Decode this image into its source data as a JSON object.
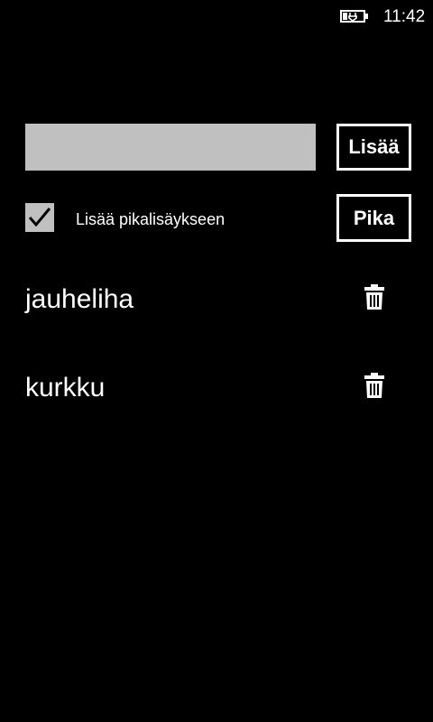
{
  "status_bar": {
    "time": "11:42",
    "battery_icon": "battery-charging-icon"
  },
  "form": {
    "input_value": "",
    "add_button_label": "Lisää",
    "quick_checkbox_checked": true,
    "quick_checkbox_label": "Lisää pikalisäykseen",
    "quick_button_label": "Pika"
  },
  "list": {
    "items": [
      {
        "label": "jauheliha",
        "delete_icon": "trash-icon"
      },
      {
        "label": "kurkku",
        "delete_icon": "trash-icon"
      }
    ]
  },
  "colors": {
    "background": "#000000",
    "foreground": "#ffffff",
    "input_fill": "#c0c0c0"
  }
}
